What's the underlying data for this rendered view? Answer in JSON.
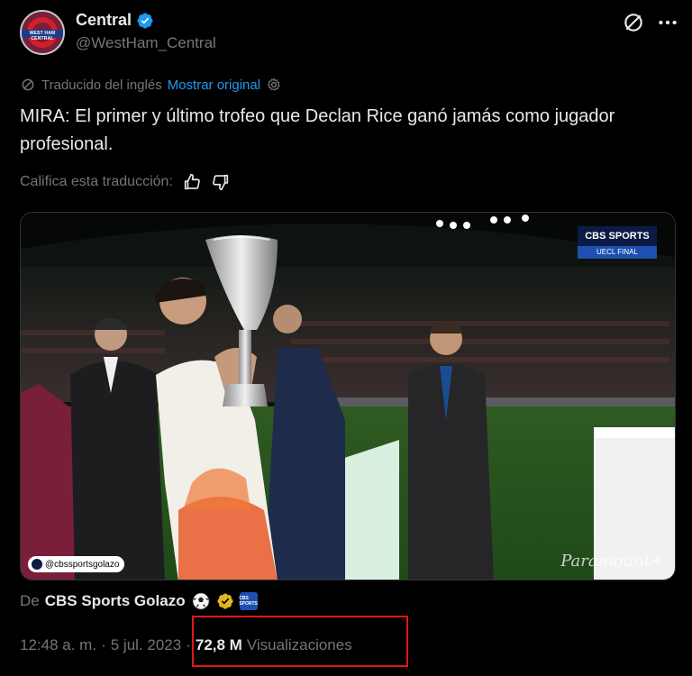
{
  "author": {
    "display_name": "Central",
    "handle": "@WestHam_Central",
    "avatar_text": "WEST HAM CENTRAL",
    "verified_color": "#1d9bf0"
  },
  "translation": {
    "label": "Traducido del inglés",
    "show_original": "Mostrar original"
  },
  "tweet_text": "MIRA: El primer y último trofeo que Declan Rice ganó jamás como jugador profesional.",
  "rate": {
    "label": "Califica esta traducción:"
  },
  "media": {
    "badge_top": "CBS SPORTS",
    "badge_bottom": "UECL FINAL",
    "source_tag": "@cbssportsgolazo",
    "watermark": "Paramount+"
  },
  "from": {
    "prefix": "De",
    "name": "CBS Sports Golazo",
    "small_badge": "CBS SPORTS"
  },
  "meta": {
    "time": "12:48 a. m.",
    "sep1": "·",
    "date": "5 jul. 2023",
    "sep2": "·",
    "views": "72,8 M",
    "views_label": "Visualizaciones"
  },
  "colors": {
    "accent": "#1d9bf0",
    "muted": "#71767b",
    "highlight": "#e01818"
  }
}
